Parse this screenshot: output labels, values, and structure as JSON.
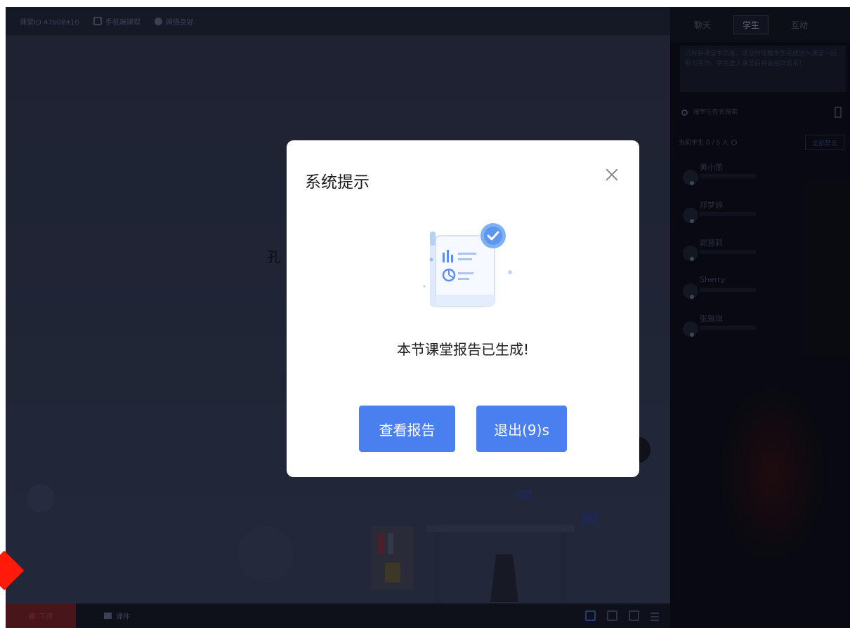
{
  "topbar": {
    "room_id": "课堂ID 47008410",
    "item1": "手机端课程",
    "item2": "网络良好"
  },
  "stage": {
    "partial_text": "孔"
  },
  "bottombar": {
    "exit_label": "下课",
    "files_label": "课件",
    "icons": [
      "gallery-view-icon",
      "screen-share-icon",
      "fullscreen-icon",
      "collapse-panel-icon"
    ]
  },
  "side": {
    "tabs": [
      {
        "label": "聊天",
        "active": false
      },
      {
        "label": "学生",
        "active": true
      },
      {
        "label": "互动",
        "active": false
      }
    ],
    "notice": "已开启课堂学员席，请及时提醒学生完成进入课堂一起参与互动，学生进入课堂后将会自动显示！",
    "search_placeholder": "按学生姓名搜索",
    "count_label": "当前学生 0 / 5 人",
    "action_button": "全部禁言",
    "students": [
      {
        "name": "黄小燕"
      },
      {
        "name": "邓梦婷"
      },
      {
        "name": "郭慧莉"
      },
      {
        "name": "Sherry"
      },
      {
        "name": "张雅琪"
      }
    ]
  },
  "modal": {
    "title": "系统提示",
    "message": "本节课堂报告已生成!",
    "view_button": "查看报告",
    "exit_button": "退出(9)s"
  },
  "colors": {
    "primary": "#4a7ff0",
    "modal_bg": "#ffffff",
    "stage_bg": "#2c3347",
    "side_bg": "#0a0c12",
    "exit_bg": "#6a1d20",
    "marker": "#ff1a0a"
  }
}
